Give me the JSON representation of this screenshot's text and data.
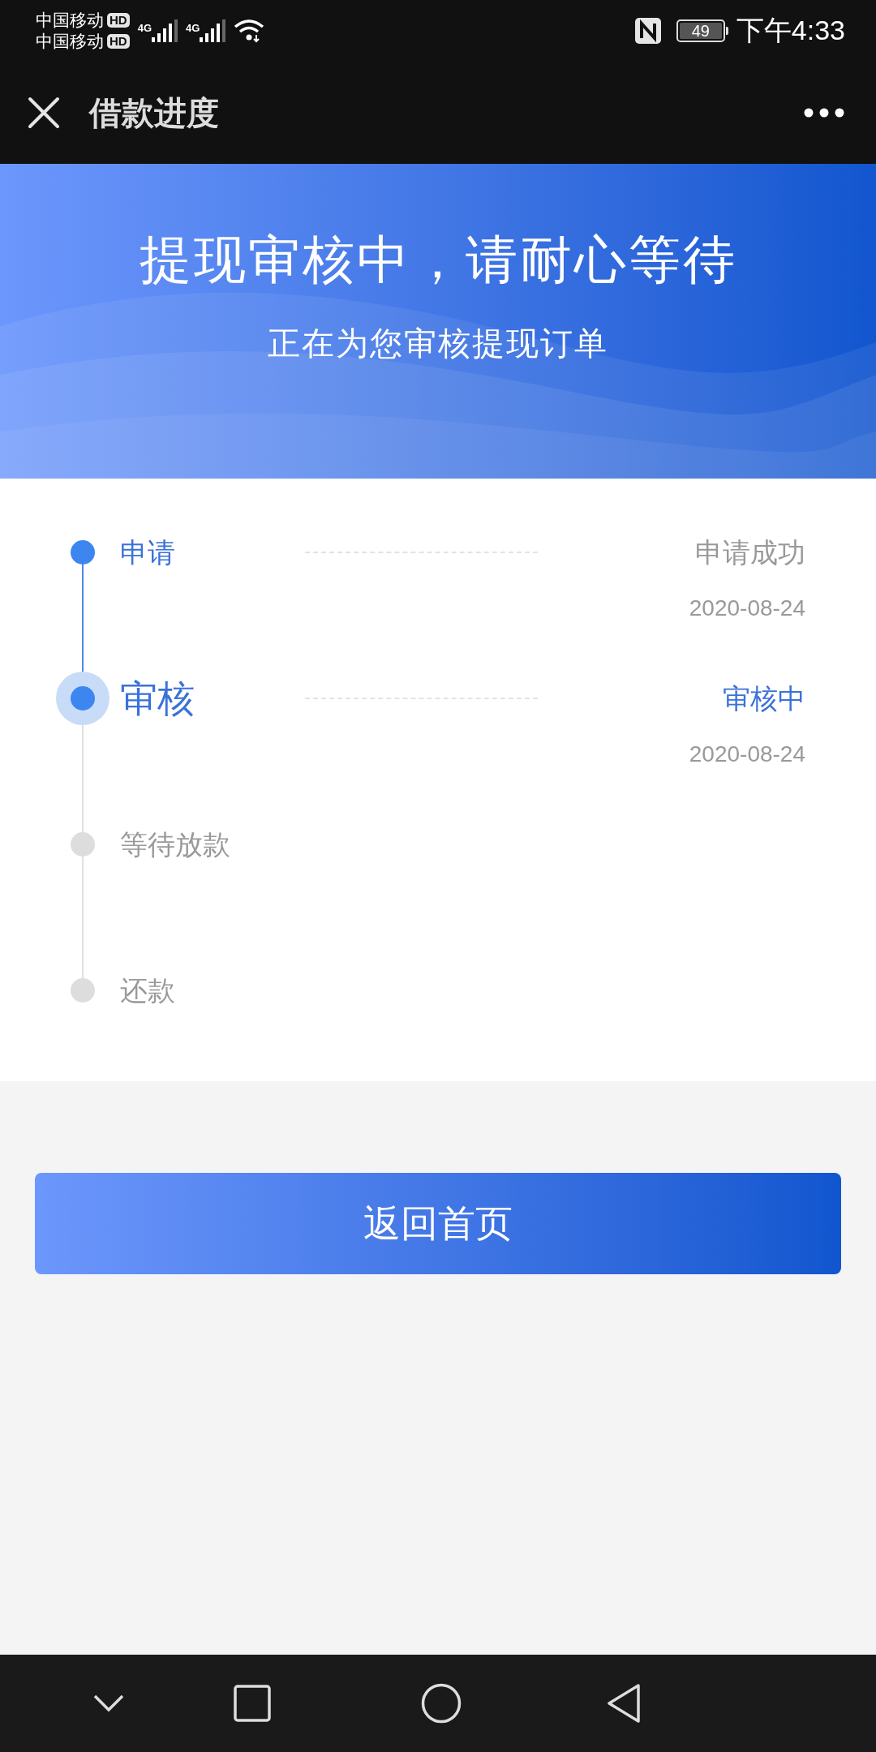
{
  "status_bar": {
    "carriers": [
      {
        "name": "中国移动",
        "badge": "HD"
      },
      {
        "name": "中国移动",
        "badge": "HD"
      }
    ],
    "networks": [
      "4G",
      "4G"
    ],
    "battery": "49",
    "time": "下午4:33"
  },
  "nav": {
    "title": "借款进度"
  },
  "banner": {
    "title": "提现审核中，请耐心等待",
    "subtitle": "正在为您审核提现订单"
  },
  "steps": [
    {
      "label": "申请",
      "done": true,
      "current": false,
      "status_text": "申请成功",
      "date": "2020-08-24"
    },
    {
      "label": "审核",
      "done": false,
      "current": true,
      "status_text": "审核中",
      "date": "2020-08-24"
    },
    {
      "label": "等待放款",
      "done": false,
      "current": false
    },
    {
      "label": "还款",
      "done": false,
      "current": false
    }
  ],
  "button": {
    "label": "返回首页"
  }
}
